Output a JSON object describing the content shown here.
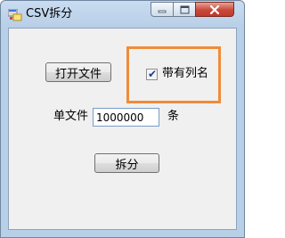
{
  "window": {
    "title": "CSV拆分",
    "controls": {
      "minimize": "minimize",
      "maximize": "maximize",
      "close": "close"
    }
  },
  "form": {
    "open_file_button": "打开文件",
    "has_header_checkbox": {
      "label": "带有列名",
      "checked": true,
      "check_glyph": "✔"
    },
    "per_file_label": "单文件",
    "rows_per_file": "1000000",
    "rows_unit": "条",
    "split_button": "拆分"
  },
  "colors": {
    "highlight_border": "#ef8c3a",
    "close_button": "#c0392b"
  }
}
